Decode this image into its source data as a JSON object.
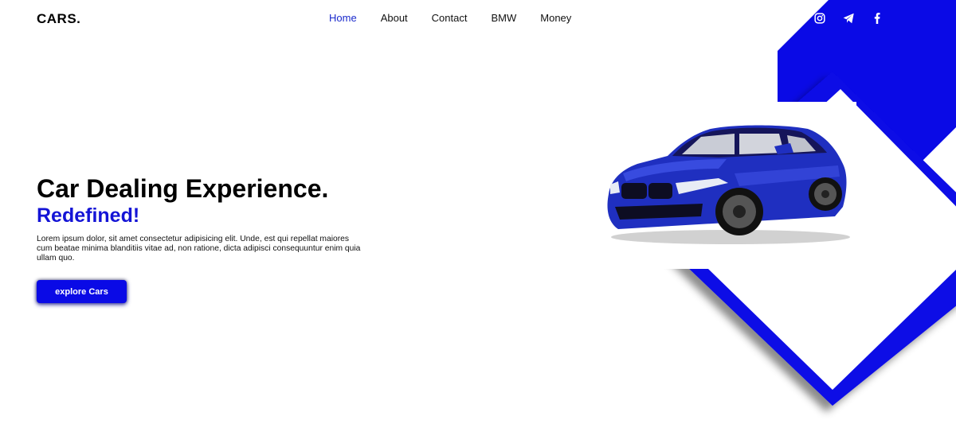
{
  "header": {
    "logo": "CARS.",
    "nav": [
      {
        "label": "Home",
        "active": true
      },
      {
        "label": "About",
        "active": false
      },
      {
        "label": "Contact",
        "active": false
      },
      {
        "label": "BMW",
        "active": false
      },
      {
        "label": "Money",
        "active": false
      }
    ],
    "social_icons": [
      "instagram-icon",
      "telegram-icon",
      "facebook-icon"
    ]
  },
  "hero": {
    "title": "Car Dealing Experience.",
    "subtitle": "Redefined!",
    "description": "Lorem ipsum dolor, sit amet consectetur adipisicing elit. Unde, est qui repellat maiores cum beatae minima blanditiis vitae ad, non ratione, dicta adipisci consequuntur enim quia ullam quo.",
    "cta_label": "explore Cars"
  },
  "colors": {
    "accent": "#0a0ae6",
    "subtitle": "#1414d6",
    "nav_active": "#1a2acc",
    "car_body": "#1f2fc0"
  }
}
